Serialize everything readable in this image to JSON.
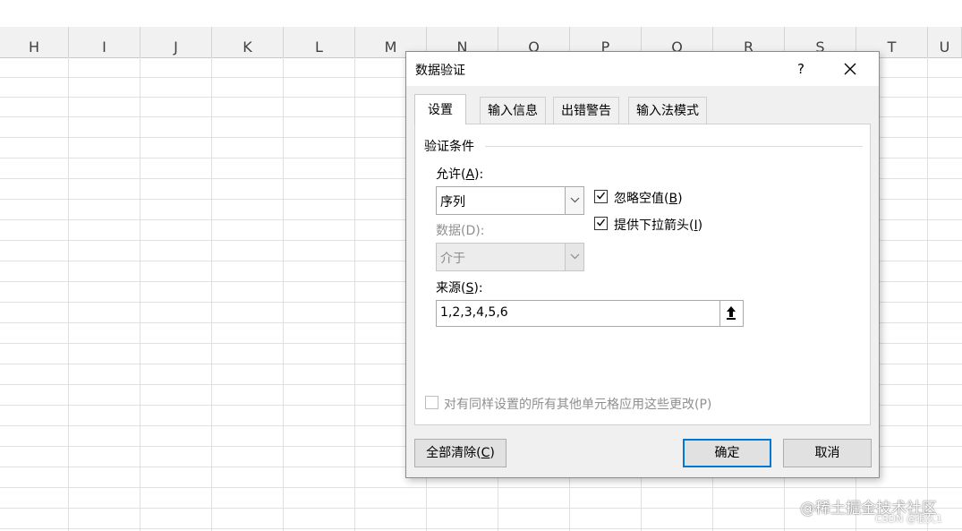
{
  "sheet": {
    "columns": [
      "H",
      "I",
      "J",
      "K",
      "L",
      "M",
      "N",
      "O",
      "P",
      "Q",
      "R",
      "S",
      "T",
      "U"
    ]
  },
  "dialog": {
    "title": "数据验证",
    "help_label": "?",
    "close_label": "✕",
    "tabs": [
      "设置",
      "输入信息",
      "出错警告",
      "输入法模式"
    ],
    "group_title": "验证条件",
    "allow": {
      "label_prefix": "允许(",
      "label_key": "A",
      "label_suffix": "):",
      "value": "序列"
    },
    "data": {
      "label": "数据(D):",
      "value": "介于"
    },
    "ignore_blank": {
      "label_prefix": "忽略空值(",
      "label_key": "B",
      "label_suffix": ")",
      "checked": true
    },
    "in_cell_dropdown": {
      "label_prefix": "提供下拉箭头(",
      "label_key": "I",
      "label_suffix": ")",
      "checked": true
    },
    "source": {
      "label_prefix": "来源(",
      "label_key": "S",
      "label_suffix": "):",
      "value": "1,2,3,4,5,6"
    },
    "apply_all": {
      "label": "对有同样设置的所有其他单元格应用这些更改(P)",
      "checked": false
    },
    "buttons": {
      "clear_prefix": "全部清除(",
      "clear_key": "C",
      "clear_suffix": ")",
      "ok": "确定",
      "cancel": "取消"
    }
  },
  "watermark": {
    "main": "@稀土掘金技术社区",
    "sub": "CSDN @很久1"
  }
}
